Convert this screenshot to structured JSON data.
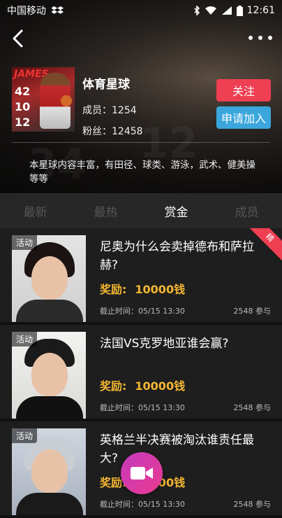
{
  "status": {
    "carrier": "中国移动",
    "time": "12:61"
  },
  "group": {
    "name": "体育星球",
    "members": "成员：1254",
    "fans": "粉丝：12458",
    "description": "本星球内容丰富，有田径、球类、游泳，武术、健美操等等",
    "follow_label": "关注",
    "join_label": "申请加入",
    "cover": {
      "title": "JAMES",
      "stats": [
        "42",
        "10",
        "12"
      ]
    }
  },
  "tabs": [
    "最新",
    "最热",
    "赏金",
    "成员"
  ],
  "active_tab": 2,
  "posts": [
    {
      "tag": "活动",
      "title": "尼奥为什么会卖掉德布和萨拉赫?",
      "reward_label": "奖励:",
      "reward_value": "10000钱",
      "deadline": "截止时间：05/15 13:30",
      "count": "2548 参与",
      "badge": "精"
    },
    {
      "tag": "活动",
      "title": "法国VS克罗地亚谁会赢?",
      "reward_label": "奖励:",
      "reward_value": "10000钱",
      "deadline": "截止时间：05/15 13:30",
      "count": "2548 参与"
    },
    {
      "tag": "活动",
      "title": "英格兰半决赛被淘汰谁责任最大?",
      "reward_label": "奖励:",
      "reward_value": "10000钱",
      "deadline": "截止时间：05/15 13:30",
      "count": "2548 参与"
    }
  ],
  "icons": {
    "back": "back-arrow-icon",
    "more": "more-dots-icon",
    "fab": "video-camera-icon"
  },
  "colors": {
    "follow": "#ef3f53",
    "join": "#3aa6dc",
    "reward": "#f2b632",
    "fab": "#d63aa8"
  }
}
